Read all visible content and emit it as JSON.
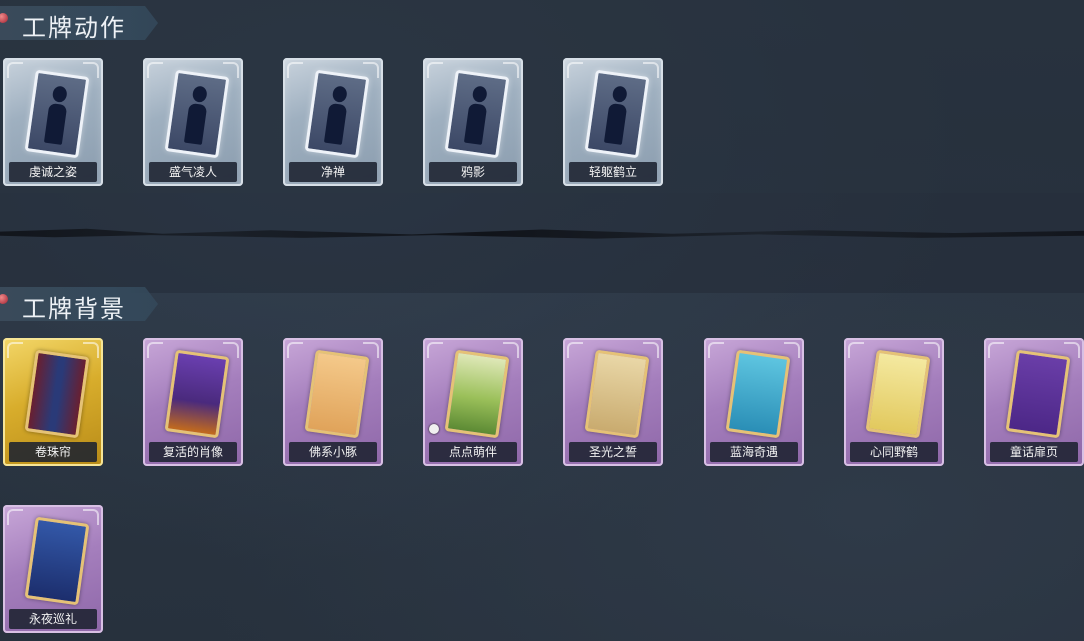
{
  "sections": {
    "actions": {
      "title": "工牌动作",
      "cards": [
        {
          "label": "虔诚之姿",
          "icon": "pose-icon"
        },
        {
          "label": "盛气凌人",
          "icon": "pose-icon"
        },
        {
          "label": "净禅",
          "icon": "pose-icon"
        },
        {
          "label": "鸦影",
          "icon": "pose-icon"
        },
        {
          "label": "轻躯鹤立",
          "icon": "pose-icon"
        }
      ]
    },
    "backgrounds": {
      "title": "工牌背景",
      "cards": [
        {
          "label": "卷珠帘",
          "rarity": "gold"
        },
        {
          "label": "复活的肖像",
          "rarity": "purple"
        },
        {
          "label": "佛系小豚",
          "rarity": "purple"
        },
        {
          "label": "点点萌伴",
          "rarity": "purple"
        },
        {
          "label": "圣光之誓",
          "rarity": "purple"
        },
        {
          "label": "蓝海奇遇",
          "rarity": "purple"
        },
        {
          "label": "心同野鹤",
          "rarity": "purple"
        },
        {
          "label": "童话扉页",
          "rarity": "purple"
        },
        {
          "label": "永夜巡礼",
          "rarity": "purple"
        }
      ]
    }
  },
  "colors": {
    "background": "#2a3442",
    "rarity_blue": "#9fb0c0",
    "rarity_purple": "#a57fbd",
    "rarity_gold": "#d8ad2c"
  }
}
